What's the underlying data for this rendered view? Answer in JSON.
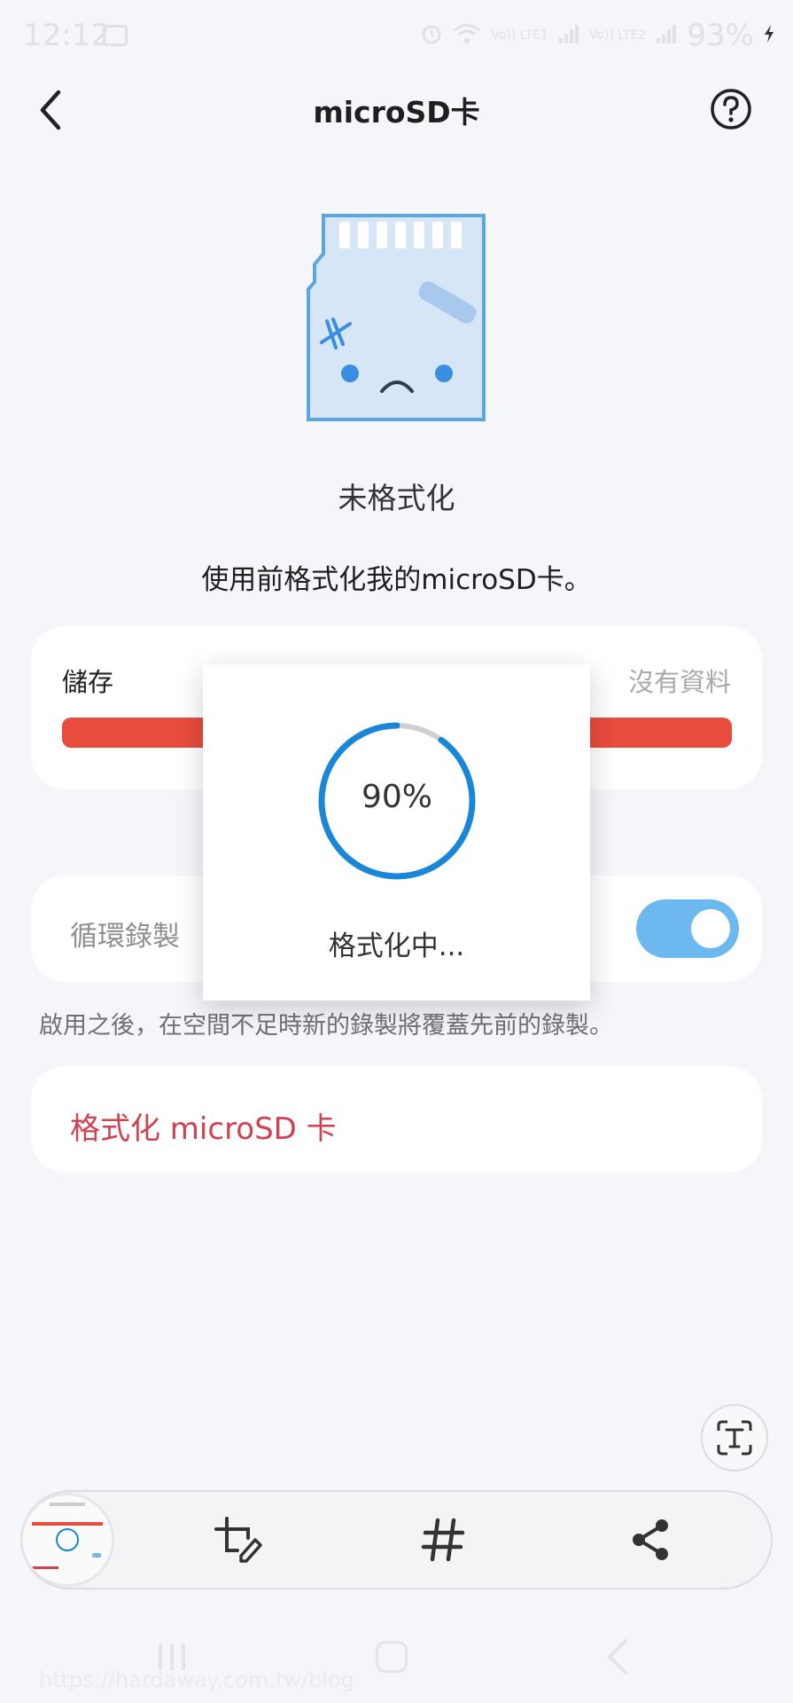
{
  "status_bar": {
    "time": "12:12",
    "net_label_1": "Vo)) LTE1",
    "net_label_2": "Vo)) LTE2",
    "battery": "93%"
  },
  "header": {
    "title": "microSD卡"
  },
  "card_status": "未格式化",
  "hint": "使用前格式化我的microSD卡。",
  "storage": {
    "label": "儲存",
    "value": "沒有資料"
  },
  "loop_recording": {
    "label": "循環錄製",
    "enabled": true,
    "description": "啟用之後，在空間不足時新的錄製將覆蓋先前的錄製。"
  },
  "format_button": {
    "label": "格式化 microSD 卡"
  },
  "dialog": {
    "progress_label": "90%",
    "progress": 0.9,
    "message": "格式化中..."
  },
  "watermark": "https://hardaway.com.tw/blog",
  "colors": {
    "accent_red": "#e84c3d",
    "format_text": "#d1414f",
    "toggle": "#6cb8ef",
    "progress": "#1a86d8"
  }
}
